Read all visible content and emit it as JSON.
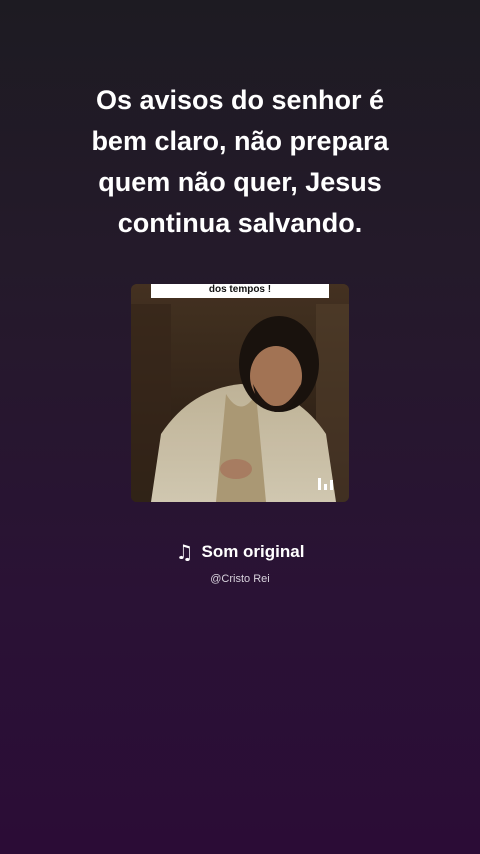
{
  "caption": "Os avisos do senhor é bem claro, não prepara quem não quer, Jesus continua salvando.",
  "thumbnail": {
    "overlay_text": "dos tempos !",
    "equalizer_icon": "bars-icon"
  },
  "sound": {
    "icon": "music-note-icon",
    "title": "Som original",
    "author": "@Cristo Rei"
  }
}
